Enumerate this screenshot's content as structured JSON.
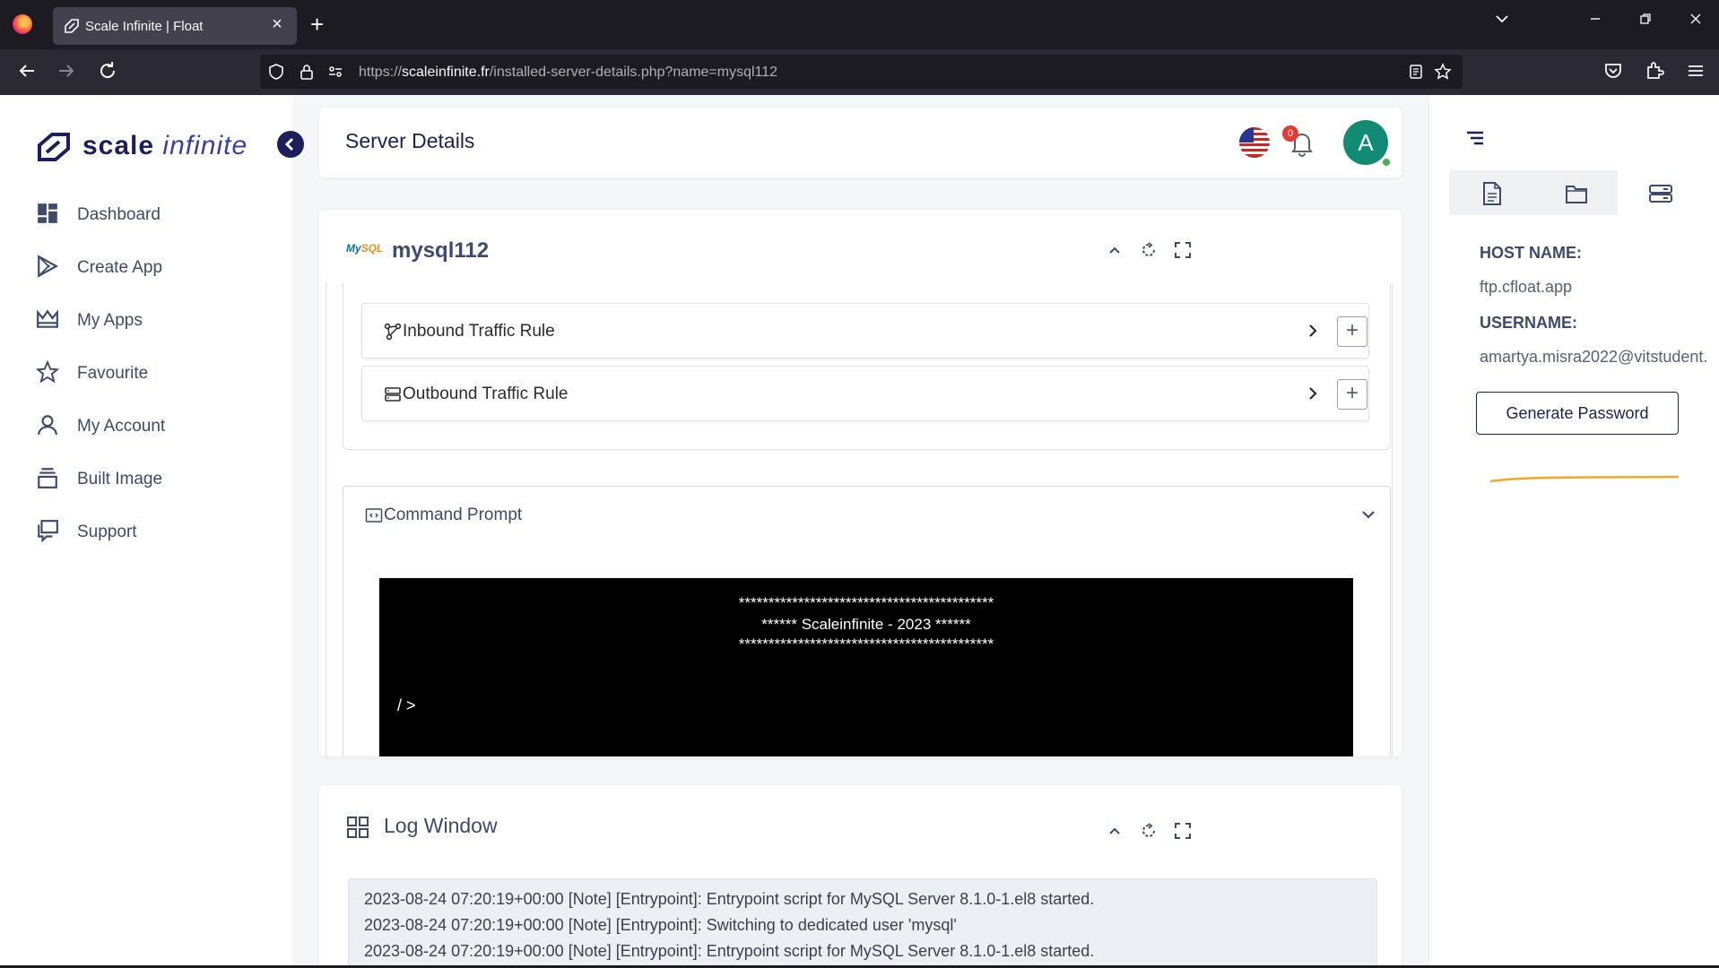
{
  "browser": {
    "tab_title": "Scale Infinite | Float",
    "new_tab": "+",
    "close_tab": "×",
    "url_prefix": "https://",
    "url_host": "scaleinfinite.fr",
    "url_path": "/installed-server-details.php?name=mysql112"
  },
  "sidebar": {
    "logo_word1": "scale",
    "logo_word2": "infinite",
    "items": [
      {
        "label": "Dashboard",
        "icon": "dashboard-icon"
      },
      {
        "label": "Create App",
        "icon": "play-icon"
      },
      {
        "label": "My Apps",
        "icon": "crown-icon"
      },
      {
        "label": "Favourite",
        "icon": "star-icon"
      },
      {
        "label": "My Account",
        "icon": "user-icon"
      },
      {
        "label": "Built Image",
        "icon": "layers-icon"
      },
      {
        "label": "Support",
        "icon": "chat-icon"
      }
    ]
  },
  "header": {
    "title": "Server Details",
    "notification_count": "0",
    "avatar_letter": "A"
  },
  "server": {
    "logo_text_1": "My",
    "logo_text_2": "SQL",
    "name": "mysql112",
    "rules": [
      {
        "label": "Inbound Traffic Rule",
        "add": "+"
      },
      {
        "label": "Outbound Traffic Rule",
        "add": "+"
      }
    ],
    "command_prompt": {
      "title": "Command Prompt",
      "stars_top": "*******************************************",
      "banner": "****** Scaleinfinite - 2023 ******",
      "stars_bottom": "*******************************************",
      "prompt": "/ >"
    }
  },
  "log_window": {
    "title": "Log Window",
    "lines": [
      "2023-08-24 07:20:19+00:00 [Note] [Entrypoint]: Entrypoint script for MySQL Server 8.1.0-1.el8 started.",
      "2023-08-24 07:20:19+00:00 [Note] [Entrypoint]: Switching to dedicated user 'mysql'",
      "2023-08-24 07:20:19+00:00 [Note] [Entrypoint]: Entrypoint script for MySQL Server 8.1.0-1.el8 started."
    ]
  },
  "right_panel": {
    "host_label": "HOST NAME:",
    "host_value": "ftp.cfloat.app",
    "username_label": "USERNAME:",
    "username_value": "amartya.misra2022@vitstudent.",
    "generate_button": "Generate Password"
  },
  "colors": {
    "brand": "#1d1f5b",
    "avatar": "#128b74",
    "badge": "#e53935",
    "underline": "#f5a623"
  }
}
